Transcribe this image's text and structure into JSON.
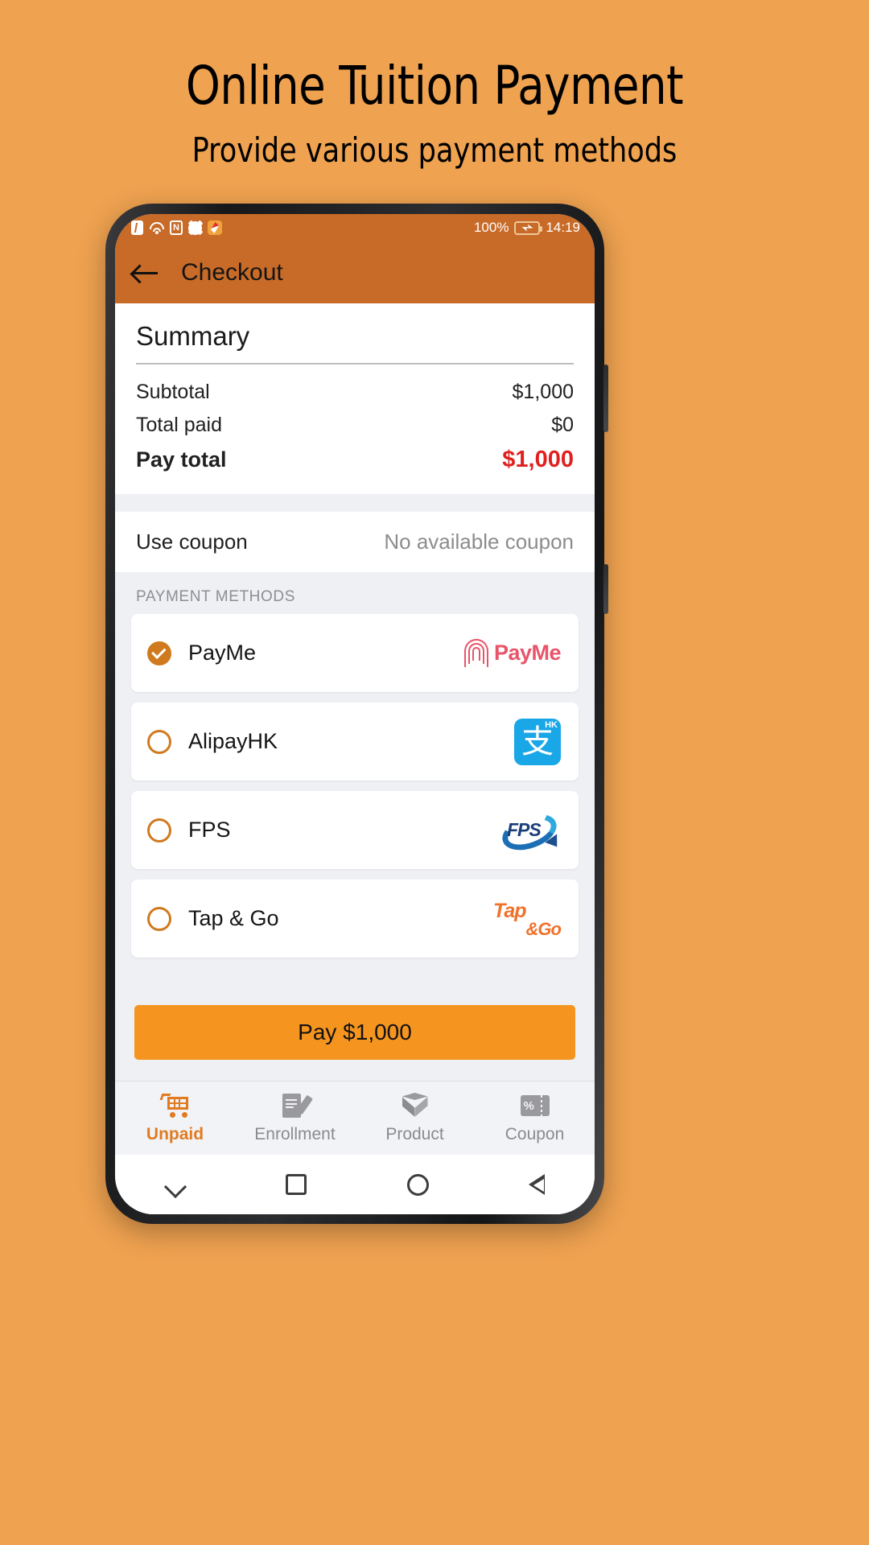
{
  "promo": {
    "title": "Online Tuition Payment",
    "subtitle": "Provide various payment methods"
  },
  "colors": {
    "page_background": "#efa250",
    "app_bar": "#c86b28",
    "accent": "#d07a1f",
    "pay_button": "#f5951f",
    "total_amount": "#e02020",
    "body_background": "#eef0f4"
  },
  "status_bar": {
    "battery_percent": "100%",
    "time": "14:19",
    "icons": [
      "bluetooth-icon",
      "wifi-icon",
      "nfc-icon",
      "gear-icon",
      "app-notification-icon",
      "battery-charging-icon"
    ]
  },
  "app_bar": {
    "back_icon": "back-arrow-icon",
    "title": "Checkout"
  },
  "summary": {
    "heading": "Summary",
    "rows": [
      {
        "label": "Subtotal",
        "value": "$1,000"
      },
      {
        "label": "Total paid",
        "value": "$0"
      }
    ],
    "total": {
      "label": "Pay total",
      "value": "$1,000"
    }
  },
  "coupon": {
    "label": "Use coupon",
    "value": "No available coupon"
  },
  "payment_methods": {
    "section_label": "PAYMENT METHODS",
    "items": [
      {
        "label": "PayMe",
        "selected": true,
        "logo": "payme-logo",
        "logo_text": "PayMe"
      },
      {
        "label": "AlipayHK",
        "selected": false,
        "logo": "alipayhk-logo",
        "logo_text": "HK"
      },
      {
        "label": "FPS",
        "selected": false,
        "logo": "fps-logo",
        "logo_text": "FPS"
      },
      {
        "label": "Tap & Go",
        "selected": false,
        "logo": "tapgo-logo",
        "logo_text": "Tap",
        "logo_text2": "&Go"
      }
    ]
  },
  "pay_button": {
    "label": "Pay $1,000"
  },
  "tab_bar": {
    "tabs": [
      {
        "label": "Unpaid",
        "icon": "cart-icon",
        "active": true
      },
      {
        "label": "Enrollment",
        "icon": "document-edit-icon",
        "active": false
      },
      {
        "label": "Product",
        "icon": "box-icon",
        "active": false
      },
      {
        "label": "Coupon",
        "icon": "coupon-icon",
        "active": false
      }
    ]
  },
  "android_nav": {
    "buttons": [
      "chevron-down-icon",
      "square-icon",
      "circle-icon",
      "back-triangle-icon"
    ]
  }
}
